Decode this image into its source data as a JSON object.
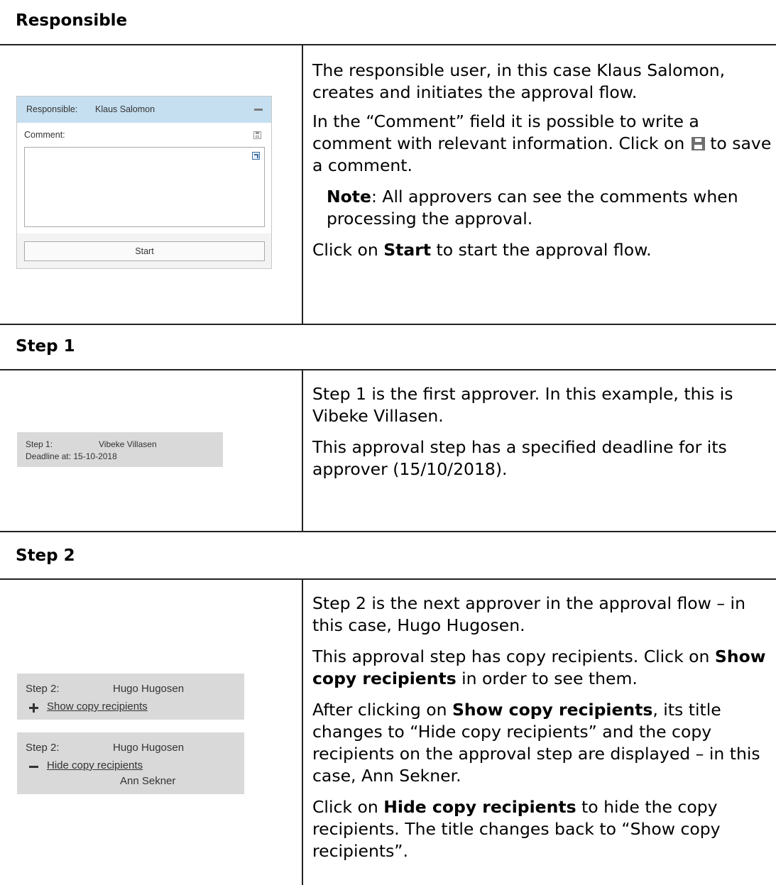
{
  "sections": {
    "responsible": {
      "heading": "Responsible",
      "panel": {
        "label": "Responsible:",
        "name": "Klaus Salomon",
        "comment_label": "Comment:",
        "comment_value": "",
        "start_label": "Start"
      },
      "desc": {
        "p1": "The responsible user, in this case Klaus Salomon, creates and initiates the approval flow.",
        "p2_before": "In the “Comment” field it is possible to write a comment with relevant information. Click on",
        "p2_after": "to save a comment.",
        "note_bold": "Note",
        "note_rest": ": All approvers can see the comments when processing the approval.",
        "p4_before": "Click on ",
        "p4_bold": "Start",
        "p4_after": " to start the approval flow."
      }
    },
    "step1": {
      "heading": "Step 1",
      "panel": {
        "label": "Step 1:",
        "name": "Vibeke Villasen",
        "deadline": "Deadline at: 15-10-2018"
      },
      "desc": {
        "p1": "Step 1 is the first approver. In this example, this is Vibeke Villasen.",
        "p2": "This approval step has a specified deadline for its approver (15/10/2018)."
      }
    },
    "step2": {
      "heading": "Step 2",
      "panel_collapsed": {
        "label": "Step 2:",
        "name": "Hugo Hugosen",
        "link": "Show copy recipients"
      },
      "panel_expanded": {
        "label": "Step 2:",
        "name": "Hugo Hugosen",
        "link": "Hide copy recipients",
        "recipient": "Ann Sekner"
      },
      "desc": {
        "p1": "Step 2 is the next approver in the approval flow – in this case, Hugo Hugosen.",
        "p2_before": "This approval step has copy recipients. Click on ",
        "p2_bold": "Show copy recipients",
        "p2_after": " in order to see them.",
        "p3_before": "After clicking on ",
        "p3_bold": "Show copy recipients",
        "p3_after": ", its title changes to “Hide copy recipients” and the copy recipients on the approval step are displayed – in this case, Ann Sekner.",
        "p4_before": "Click on ",
        "p4_bold": "Hide copy recipients",
        "p4_after": " to hide the copy recipients. The title changes back to “Show copy recipients”."
      }
    }
  },
  "icons": {
    "collapse": "minus-icon",
    "save": "save-icon",
    "expand": "expand-icon",
    "show": "plus-icon",
    "hide": "minus-icon"
  },
  "colors": {
    "responsible_header": "#c5dff0",
    "step_panel": "#d9d9d9"
  }
}
